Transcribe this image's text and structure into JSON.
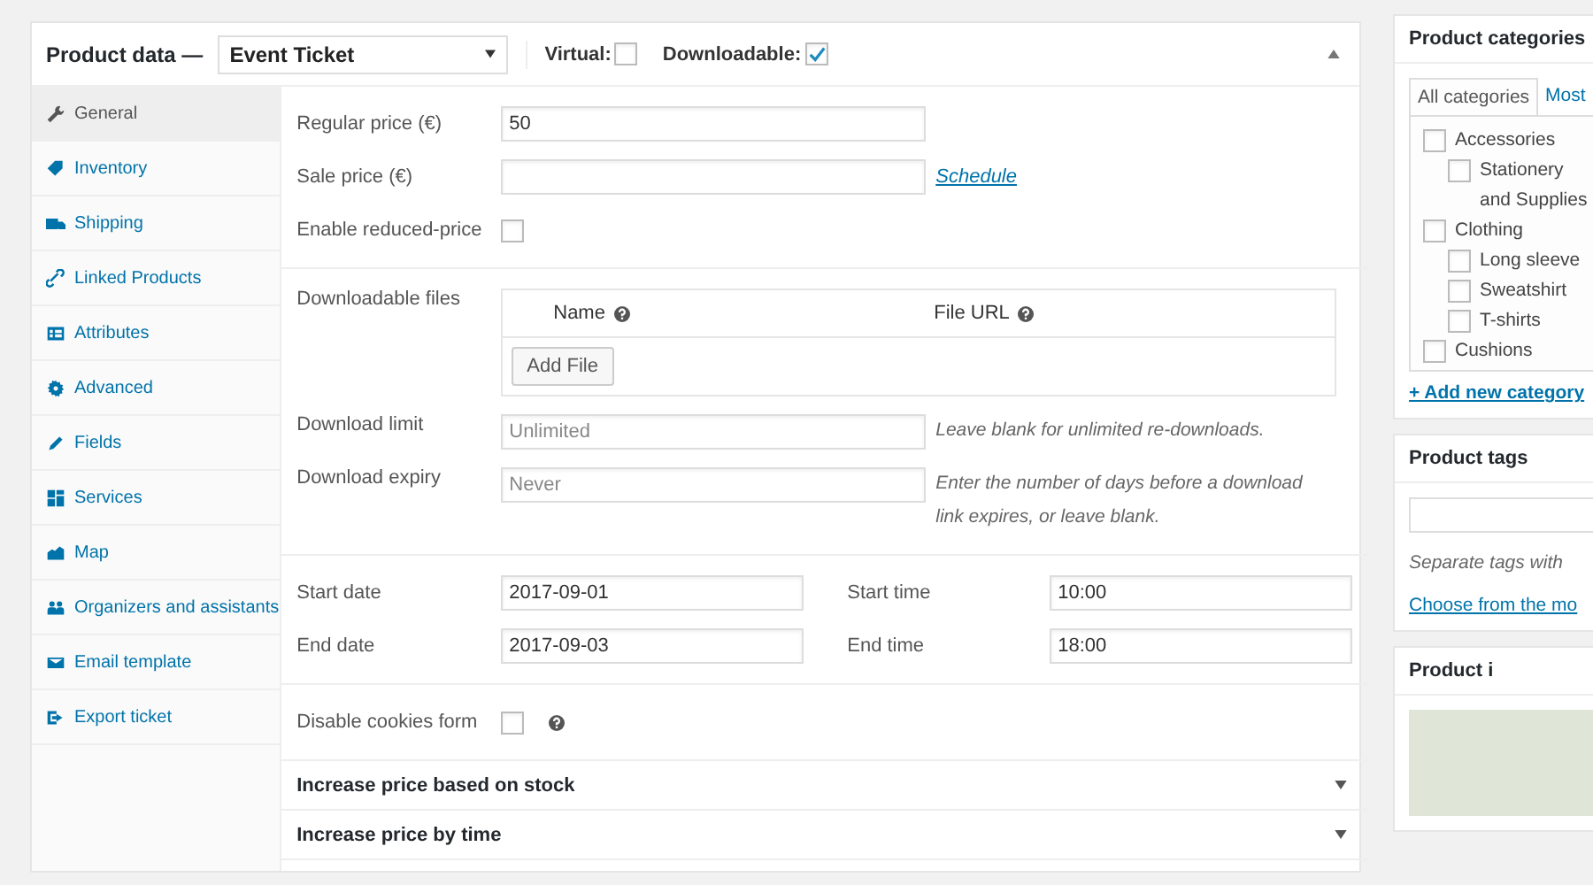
{
  "product_data": {
    "title": "Product data —",
    "type_select": {
      "value": "Event Ticket"
    },
    "options": [
      {
        "label": "Virtual:",
        "checked": false
      },
      {
        "label": "Downloadable:",
        "checked": true
      }
    ],
    "expanded": true
  },
  "tabs": [
    {
      "label": "General",
      "selected": true
    },
    {
      "label": "Inventory",
      "selected": false
    },
    {
      "label": "Shipping",
      "selected": false
    },
    {
      "label": "Linked Products",
      "selected": false
    },
    {
      "label": "Attributes",
      "selected": false
    },
    {
      "label": "Advanced",
      "selected": false
    },
    {
      "label": "Fields",
      "selected": false
    },
    {
      "label": "Services",
      "selected": false
    },
    {
      "label": "Map",
      "selected": false
    },
    {
      "label": "Organizers and assistants",
      "selected": false
    },
    {
      "label": "Email template",
      "selected": false
    },
    {
      "label": "Export ticket",
      "selected": false
    }
  ],
  "pricing": {
    "regular_price": {
      "label": "Regular price (€)",
      "value": "50"
    },
    "sale_price": {
      "label": "Sale price (€)",
      "link": "Schedule"
    },
    "reduced_price": {
      "label": "Enable reduced-price",
      "checked": false
    }
  },
  "downloads": {
    "label": "Downloadable files",
    "columns": [
      "Name",
      "File URL"
    ],
    "add_button": "Add File",
    "limit": {
      "label": "Download limit",
      "placeholder": "Unlimited",
      "hint": "Leave blank for unlimited re-downloads."
    },
    "expiry": {
      "label": "Download expiry",
      "placeholder": "Never",
      "hint": "Enter the number of days before a download link expires, or leave blank."
    }
  },
  "event": [
    {
      "date_label": "Start date",
      "date": "2017-09-01",
      "time_label": "Start time",
      "time": "10:00"
    },
    {
      "date_label": "End date",
      "date": "2017-09-03",
      "time_label": "End time",
      "time": "18:00"
    }
  ],
  "cookies": {
    "label": "Disable cookies form",
    "checked": false
  },
  "collapsibles": [
    {
      "title": "Increase price based on stock",
      "expanded": false
    },
    {
      "title": "Increase price by time",
      "expanded": false
    }
  ],
  "side": {
    "categories": {
      "title": "Product categories",
      "tabs": [
        {
          "label": "All categories",
          "selected": true
        },
        {
          "label": "Most",
          "selected": false
        }
      ],
      "items": [
        {
          "label": "Accessories",
          "checked": false,
          "children": [
            {
              "label": "Stationery and Supplies",
              "checked": false
            }
          ]
        },
        {
          "label": "Clothing",
          "checked": false,
          "children": [
            {
              "label": "Long sleeve",
              "checked": false
            },
            {
              "label": "Sweatshirt",
              "checked": false
            },
            {
              "label": "T-shirts",
              "checked": false
            }
          ]
        },
        {
          "label": "Cushions",
          "checked": false
        }
      ],
      "add_link": "+ Add new category"
    },
    "tags": {
      "title": "Product tags",
      "hint": "Separate tags with",
      "link": "Choose from the mo"
    },
    "image": {
      "title": "Product i"
    }
  }
}
